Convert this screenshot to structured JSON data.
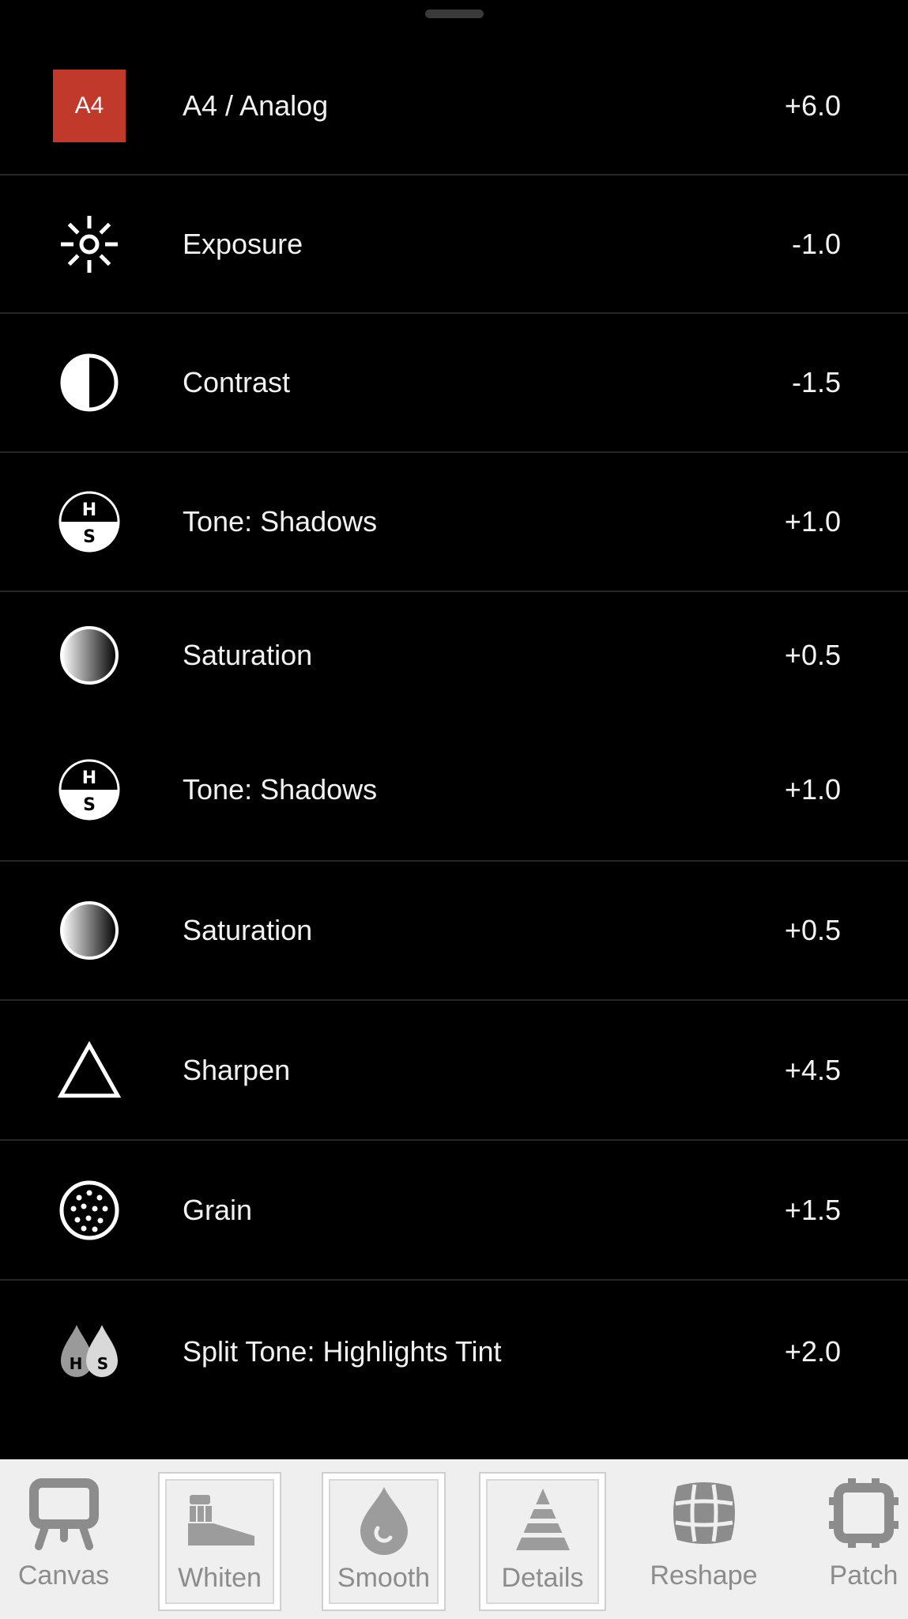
{
  "adjustments": [
    {
      "icon": "preset-badge-icon",
      "badge_text": "A4",
      "label": "A4 / Analog",
      "value": "+6.0"
    },
    {
      "icon": "exposure-sun-icon",
      "label": "Exposure",
      "value": "-1.0"
    },
    {
      "icon": "contrast-half-circle-icon",
      "label": "Contrast",
      "value": "-1.5"
    },
    {
      "icon": "tone-hs-icon",
      "label": "Tone: Shadows",
      "value": "+1.0"
    },
    {
      "icon": "saturation-gradient-icon",
      "label": "Saturation",
      "value": "+0.5"
    },
    {
      "icon": "tone-hs-icon",
      "label": "Tone: Shadows",
      "value": "+1.0"
    },
    {
      "icon": "saturation-gradient-icon",
      "label": "Saturation",
      "value": "+0.5"
    },
    {
      "icon": "sharpen-triangle-icon",
      "label": "Sharpen",
      "value": "+4.5"
    },
    {
      "icon": "grain-dots-icon",
      "label": "Grain",
      "value": "+1.5"
    },
    {
      "icon": "split-tone-drops-icon",
      "label": "Split Tone: Highlights Tint",
      "value": "+2.0"
    }
  ],
  "icon_glyphs": {
    "hs_top": "H",
    "hs_bottom": "S"
  },
  "toolbar": {
    "tools": [
      {
        "icon": "canvas-easel-icon",
        "label": "Canvas"
      },
      {
        "icon": "whiten-toothbrush-icon",
        "label": "Whiten"
      },
      {
        "icon": "smooth-drop-icon",
        "label": "Smooth"
      },
      {
        "icon": "details-cone-icon",
        "label": "Details"
      },
      {
        "icon": "reshape-grid-icon",
        "label": "Reshape"
      },
      {
        "icon": "patch-bandage-icon",
        "label": "Patch"
      }
    ]
  },
  "colors": {
    "background": "#000000",
    "preset_badge": "#c0392b",
    "toolbar_background": "#efefef",
    "toolbar_text": "#8c8c8c"
  }
}
